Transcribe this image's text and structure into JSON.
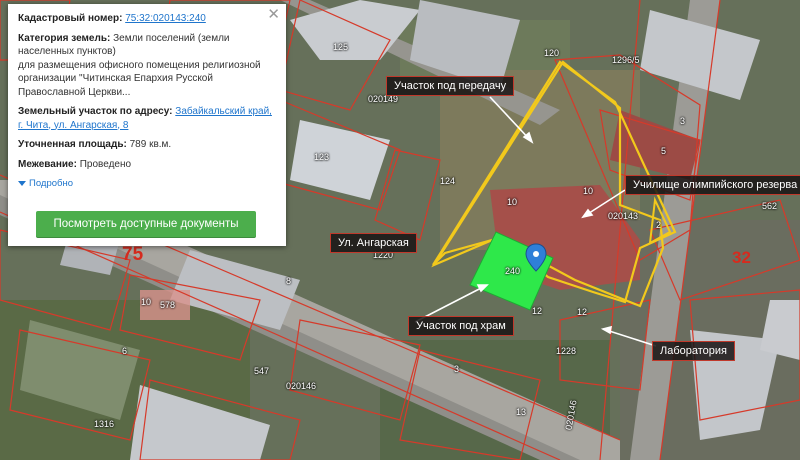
{
  "popup": {
    "cadastral_label": "Кадастровый номер:",
    "cadastral_number": "75:32:020143:240",
    "category_label": "Категория земель:",
    "category_value": "Земли поселений (земли населенных пунктов)",
    "purpose": "для размещения офисного помещения религиозной организации \"Читинская Епархия Русской Православной Церкви...",
    "address_label": "Земельный участок по адресу:",
    "address_link": "Забайкальский край, г. Чита, ул. Ангарская, 8",
    "area_label": "Уточненная площадь:",
    "area_value": "789 кв.м.",
    "survey_label": "Межевание:",
    "survey_value": "Проведено",
    "more_label": "Подробно",
    "docs_button": "Посмотреть доступные документы",
    "close_icon": "close-icon"
  },
  "callouts": {
    "transfer_plot": "Участок под передачу",
    "olympic_school": "Училище олимпийского резерва",
    "street": "Ул. Ангарская",
    "temple_plot": "Участок под храм",
    "laboratory": "Лаборатория"
  },
  "map_numbers": {
    "quarter_75": "75",
    "quarter_32": "32",
    "n120": "120",
    "n1296": "1296/5",
    "n020149": "020149",
    "n125": "125",
    "n123": "123",
    "n124": "124",
    "n3": "3",
    "n5": "5",
    "n10a": "10",
    "n10b": "10",
    "n020143": "020143",
    "n2": "2",
    "n562": "562",
    "n240": "240",
    "n12": "12",
    "n12b": "12",
    "n1228": "1228",
    "n1220": "1220",
    "n8": "8",
    "n10c": "10",
    "n578": "578",
    "n6": "6",
    "n547": "547",
    "n020146": "020146",
    "n3b": "3",
    "n13": "13",
    "n020146b": "020146",
    "n1316": "1316"
  },
  "colors": {
    "highlight_outline": "#f2c91c",
    "temple_fill": "#2ee84a",
    "cadastral_lines": "#d63a2a",
    "marker": "#2f7fd8",
    "button": "#4cae4c"
  }
}
